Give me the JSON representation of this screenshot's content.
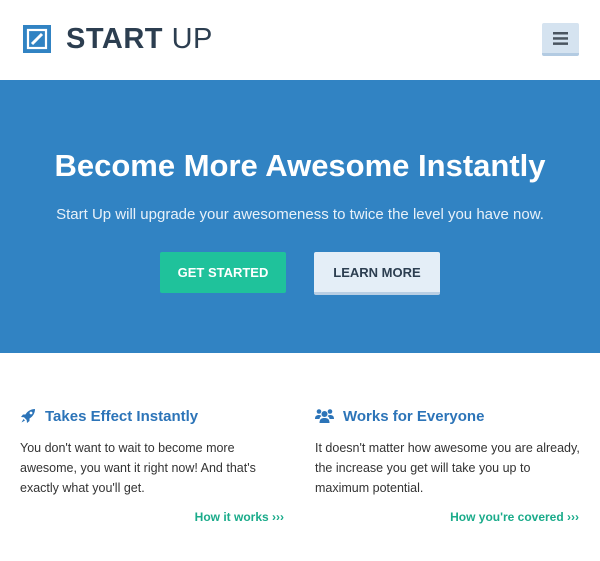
{
  "header": {
    "logo_name": "START UP",
    "logo_strong": "START",
    "logo_light": "UP",
    "menu_icon": "hamburger-menu-icon"
  },
  "hero": {
    "title": "Become More Awesome Instantly",
    "subtitle": "Start Up will upgrade your awesomeness to twice the level you have now.",
    "primary_button": "GET STARTED",
    "secondary_button": "LEARN MORE"
  },
  "features": [
    {
      "icon": "rocket-icon",
      "title": "Takes Effect Instantly",
      "text": "You don't want to wait to become more awesome, you want it right now! And that's exactly what you'll get.",
      "link": "How it works ›››"
    },
    {
      "icon": "users-icon",
      "title": "Works for Everyone",
      "text": "It doesn't matter how awesome you are already, the increase you get will take you up to maximum potential.",
      "link": "How you're covered ›››"
    }
  ],
  "colors": {
    "brand_blue": "#3183c3",
    "accent_green": "#1fc29b",
    "link_green": "#1aab8a",
    "heading_blue": "#2c74b8",
    "dark_text": "#2c3e50"
  }
}
